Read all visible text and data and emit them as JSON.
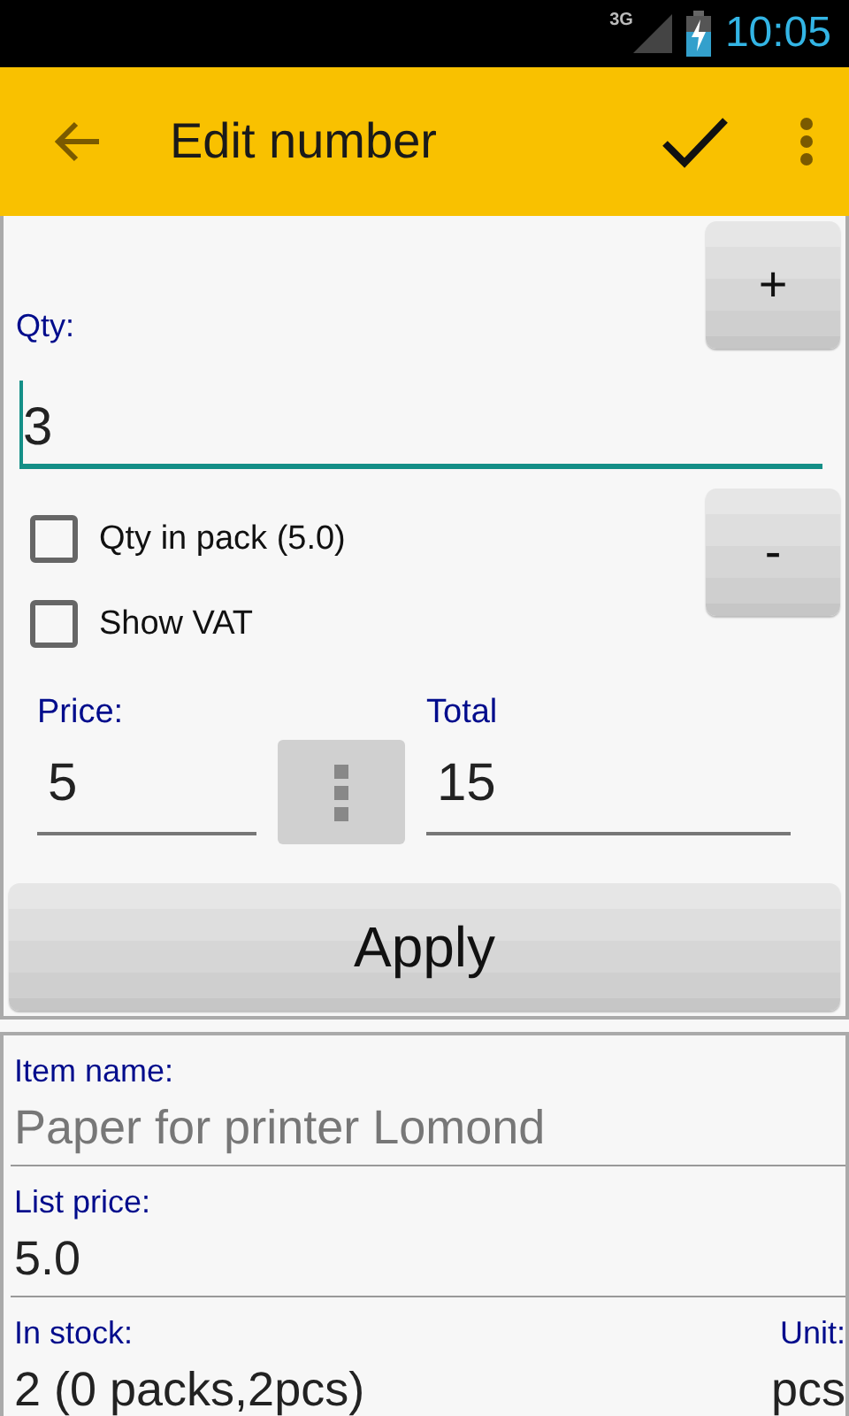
{
  "status_bar": {
    "network": "3G",
    "time": "10:05"
  },
  "app_bar": {
    "title": "Edit number"
  },
  "quantity": {
    "plus_button": "+",
    "label": "Qty:",
    "value": "3",
    "minus_button": "-"
  },
  "options": [
    {
      "label": "Qty in pack (5.0)",
      "checked": false
    },
    {
      "label": "Show VAT",
      "checked": false
    }
  ],
  "price": {
    "label": "Price:",
    "value": "5"
  },
  "total": {
    "label": "Total",
    "value": "15"
  },
  "apply_button": "Apply",
  "details": [
    {
      "fields": [
        {
          "label": "Item name:",
          "value": "Paper for printer Lomond",
          "disabled": true
        }
      ]
    },
    {
      "fields": [
        {
          "label": "List price:",
          "value": "5.0",
          "disabled": false
        }
      ]
    },
    {
      "fields": [
        {
          "label": "In stock:",
          "value": "2 (0 packs,2pcs)",
          "disabled": false
        },
        {
          "label": "Unit:",
          "value": "pcs",
          "disabled": false
        }
      ]
    }
  ]
}
